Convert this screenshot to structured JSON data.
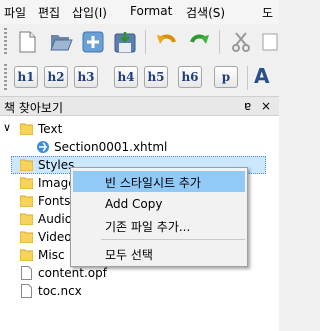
{
  "menu": {
    "file": "파일",
    "edit": "편집",
    "insert": "삽입(I)",
    "format": "Format",
    "search": "검색(S)",
    "tools_partial": "도"
  },
  "toolbar2": {
    "h1": "h1",
    "h2": "h2",
    "h3": "h3",
    "h4": "h4",
    "h5": "h5",
    "h6": "h6",
    "p": "p",
    "a": "A"
  },
  "panel": {
    "title": "책 찾아보기",
    "float_glyph": "ɐ",
    "close_glyph": "×"
  },
  "tree": {
    "expand_glyph": "∨",
    "items": [
      {
        "label": "Text"
      },
      {
        "label": "Section0001.xhtml"
      },
      {
        "label": "Styles"
      },
      {
        "label": "Images"
      },
      {
        "label": "Fonts"
      },
      {
        "label": "Audio"
      },
      {
        "label": "Video"
      },
      {
        "label": "Misc"
      },
      {
        "label": "content.opf"
      },
      {
        "label": "toc.ncx"
      }
    ]
  },
  "context_menu": {
    "items": [
      {
        "label": "빈 스타일시트 추가"
      },
      {
        "label": "Add Copy"
      },
      {
        "label": "기존 파일 추가..."
      },
      {
        "label": "모두 선택"
      }
    ]
  },
  "colors": {
    "folder": "#f7d35c",
    "selection": "#cce8ff",
    "menu_hover": "#91c9f7",
    "heading_button_text": "#1f3f7a"
  }
}
